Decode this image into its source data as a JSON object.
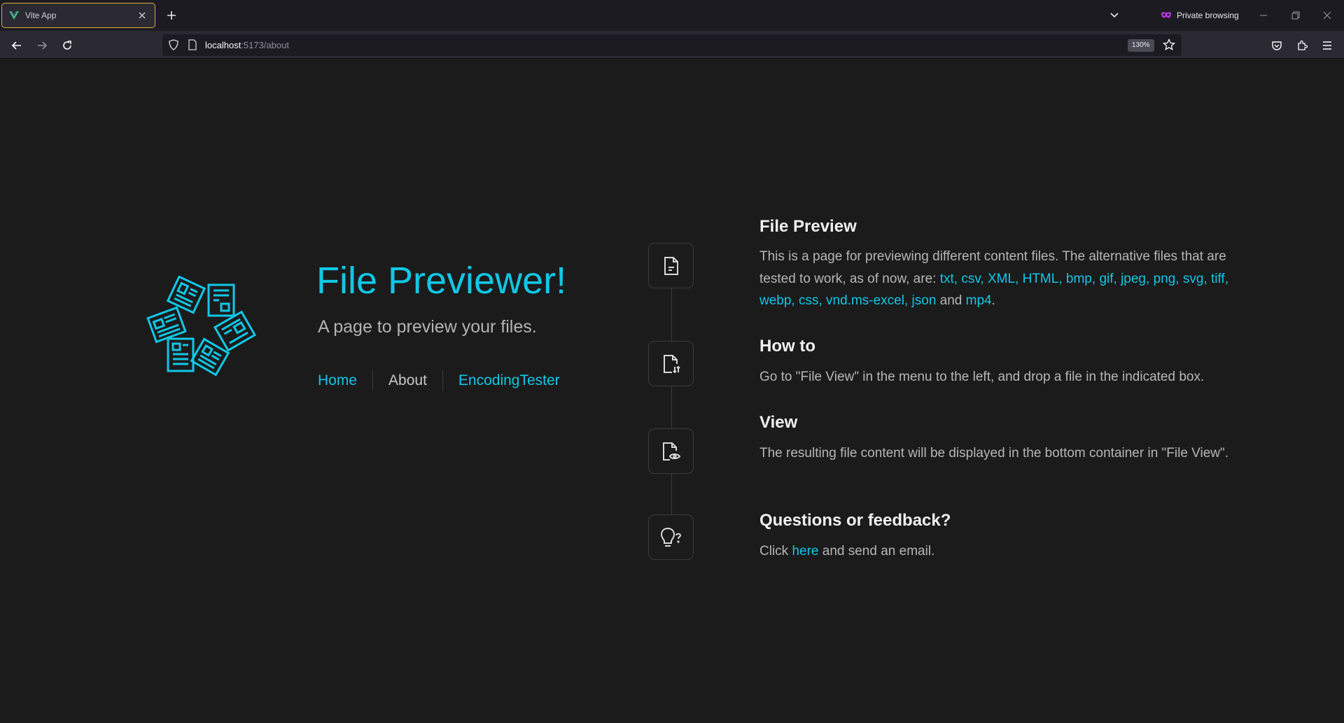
{
  "browser": {
    "tab_title": "Vite App",
    "url_host": "localhost",
    "url_path": ":5173/about",
    "zoom": "130%",
    "private_label": "Private browsing"
  },
  "hero": {
    "title": "File Previewer!",
    "subtitle": "A page to preview your files."
  },
  "nav": {
    "home": "Home",
    "about": "About",
    "encoding": "EncodingTester"
  },
  "sections": {
    "preview": {
      "title": "File Preview",
      "intro": "This is a page for previewing different content files. The alternative files that are tested to work, as of now, are: ",
      "types": [
        "txt",
        "csv",
        "XML",
        "HTML",
        "bmp",
        "gif",
        "jpeg",
        "png",
        "svg",
        "tiff",
        "webp",
        "css",
        "vnd.ms-excel",
        "json"
      ],
      "and_word": " and ",
      "last_type": "mp4",
      "end": "."
    },
    "howto": {
      "title": "How to",
      "body": "Go to \"File View\" in the menu to the left, and drop a file in the indicated box."
    },
    "view": {
      "title": "View",
      "body": "The resulting file content will be displayed in the bottom container in \"File View\"."
    },
    "feedback": {
      "title": "Questions or feedback?",
      "pre": "Click ",
      "link": "here",
      "post": " and send an email."
    }
  },
  "colors": {
    "accent": "#11c7e6",
    "background": "#1b1b1b",
    "tab_border": "#e0a93a"
  }
}
